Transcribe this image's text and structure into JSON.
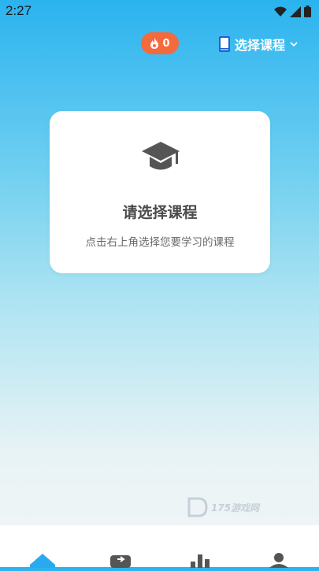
{
  "status_bar": {
    "time": "2:27"
  },
  "header": {
    "streak_count": "0",
    "course_select_label": "选择课程",
    "accent_color": "#f46a3c"
  },
  "empty_state": {
    "title": "请选择课程",
    "subtitle": "点击右上角选择您要学习的课程"
  },
  "watermark": {
    "text": "175游戏网"
  },
  "tabbar": {
    "active_color": "#29aaf0",
    "tabs": [
      {
        "icon": "home-icon"
      },
      {
        "icon": "book-icon"
      },
      {
        "icon": "stats-icon"
      },
      {
        "icon": "profile-icon"
      }
    ]
  }
}
